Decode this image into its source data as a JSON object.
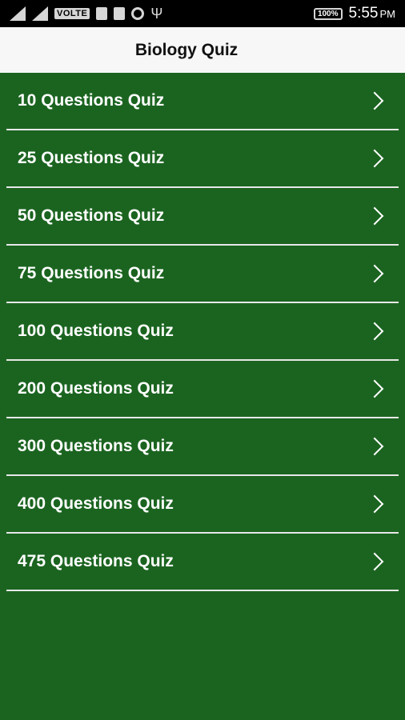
{
  "status_bar": {
    "volte": "VOLTE",
    "battery": "100%",
    "time": "5:55",
    "ampm": "PM"
  },
  "app_bar": {
    "title": "Biology Quiz"
  },
  "quizzes": [
    {
      "label": "10 Questions Quiz"
    },
    {
      "label": "25 Questions Quiz"
    },
    {
      "label": "50 Questions Quiz"
    },
    {
      "label": "75 Questions Quiz"
    },
    {
      "label": "100 Questions Quiz"
    },
    {
      "label": "200 Questions Quiz"
    },
    {
      "label": "300 Questions Quiz"
    },
    {
      "label": "400 Questions Quiz"
    },
    {
      "label": "475 Questions Quiz"
    }
  ],
  "colors": {
    "background": "#1b6420",
    "app_bar": "#f7f7f7",
    "divider": "#e8e8e8"
  }
}
